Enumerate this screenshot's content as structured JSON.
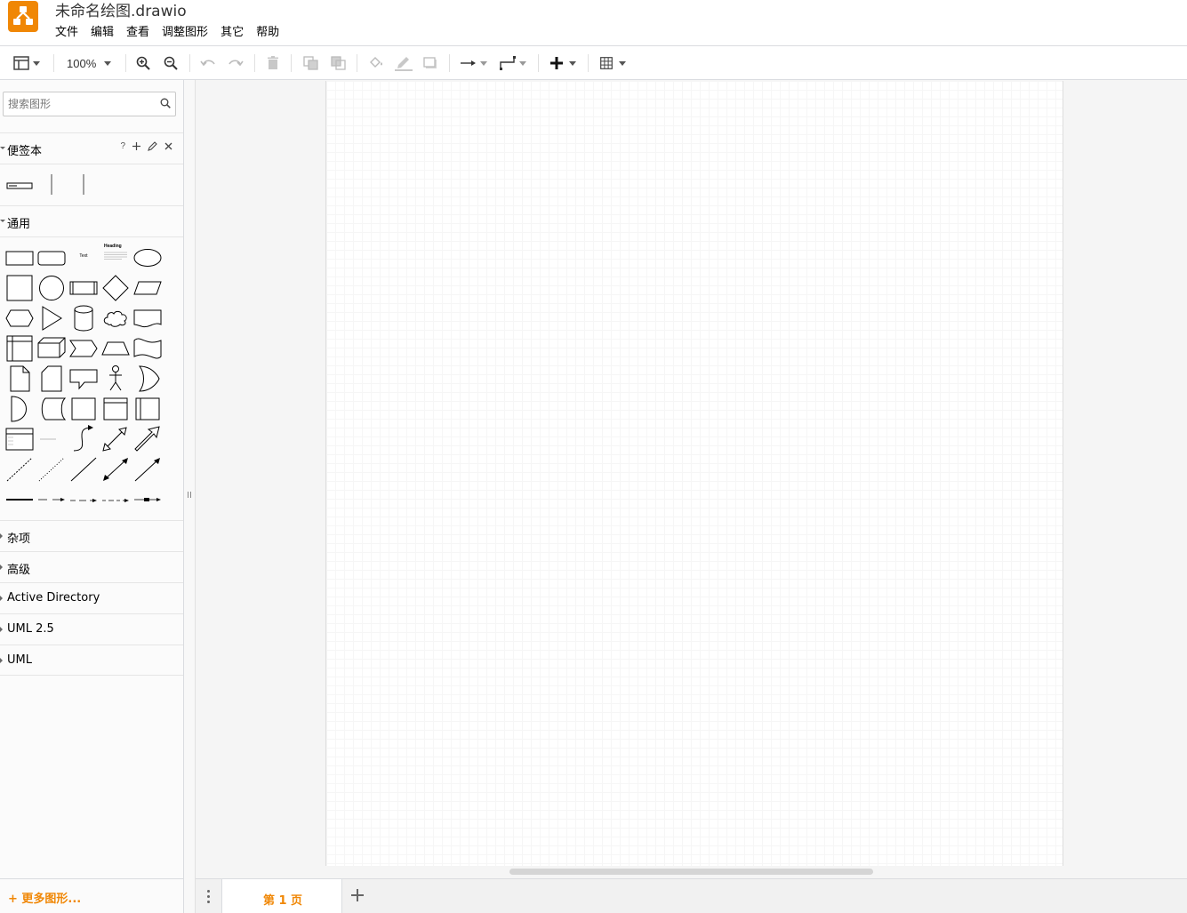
{
  "app": {
    "title": "未命名绘图.drawio",
    "brand_color": "#f08705"
  },
  "menu": [
    "文件",
    "编辑",
    "查看",
    "调整图形",
    "其它",
    "帮助"
  ],
  "toolbar": {
    "zoom": "100%",
    "icons": [
      "format-panel-icon",
      "zoom-in-icon",
      "zoom-out-icon",
      "undo-icon",
      "redo-icon",
      "delete-icon",
      "to-front-icon",
      "to-back-icon",
      "fill-color-icon",
      "line-color-icon",
      "shadow-icon",
      "connection-arrow-icon",
      "waypoints-icon",
      "insert-plus-icon",
      "table-icon"
    ]
  },
  "sidebar": {
    "search_placeholder": "搜索图形",
    "scratchpad": {
      "title": "便签本",
      "help": "?"
    },
    "general": {
      "title": "通用",
      "text_shape_label": "Text",
      "heading_shape_label": "Heading"
    },
    "collapsed_sections": [
      "杂项",
      "高级",
      "Active Directory",
      "UML 2.5",
      "UML"
    ],
    "more_shapes": "+ 更多图形..."
  },
  "footer": {
    "page_tab": "第 1 页"
  }
}
